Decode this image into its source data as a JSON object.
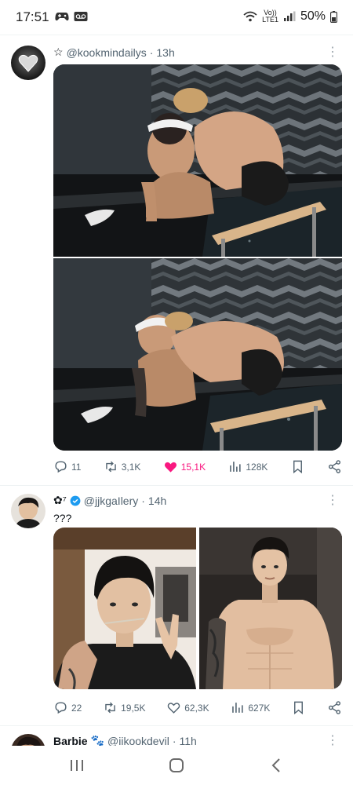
{
  "status": {
    "time": "17:51",
    "carrier_top": "Vo))",
    "carrier_bottom": "LTE1",
    "battery": "50%"
  },
  "icons": {
    "status_left": [
      "game-controller-icon",
      "voicemail-icon"
    ],
    "status_right": [
      "wifi-icon",
      "signal-icon",
      "battery-icon"
    ],
    "actions": [
      "reply-icon",
      "retweet-icon",
      "like-icon",
      "views-icon",
      "bookmark-icon",
      "share-icon"
    ],
    "nav": [
      "recent-apps-icon",
      "home-icon",
      "back-icon"
    ]
  },
  "colors": {
    "like_active": "#f91880",
    "verified": "#1d9bf0",
    "muted": "#536471",
    "text": "#0f1419"
  },
  "tweets": [
    {
      "author_prefix": "☆",
      "handle": "@kookmindailys",
      "separator": "·",
      "time": "13h",
      "more": "⋮",
      "text": "",
      "stats": {
        "replies": "11",
        "retweets": "3,1K",
        "likes": "15,1K",
        "views": "128K"
      },
      "liked": true
    },
    {
      "author_prefix": "✿⁷",
      "verified": true,
      "handle": "@jjkgaIlery",
      "separator": "·",
      "time": "14h",
      "more": "⋮",
      "text": "???",
      "stats": {
        "replies": "22",
        "retweets": "19,5K",
        "likes": "62,3K",
        "views": "627K"
      },
      "liked": false
    },
    {
      "name": "Barbie",
      "name_emoji": "🐾",
      "handle": "@iikookdevil",
      "separator": "·",
      "time": "11h",
      "more": "⋮"
    }
  ]
}
